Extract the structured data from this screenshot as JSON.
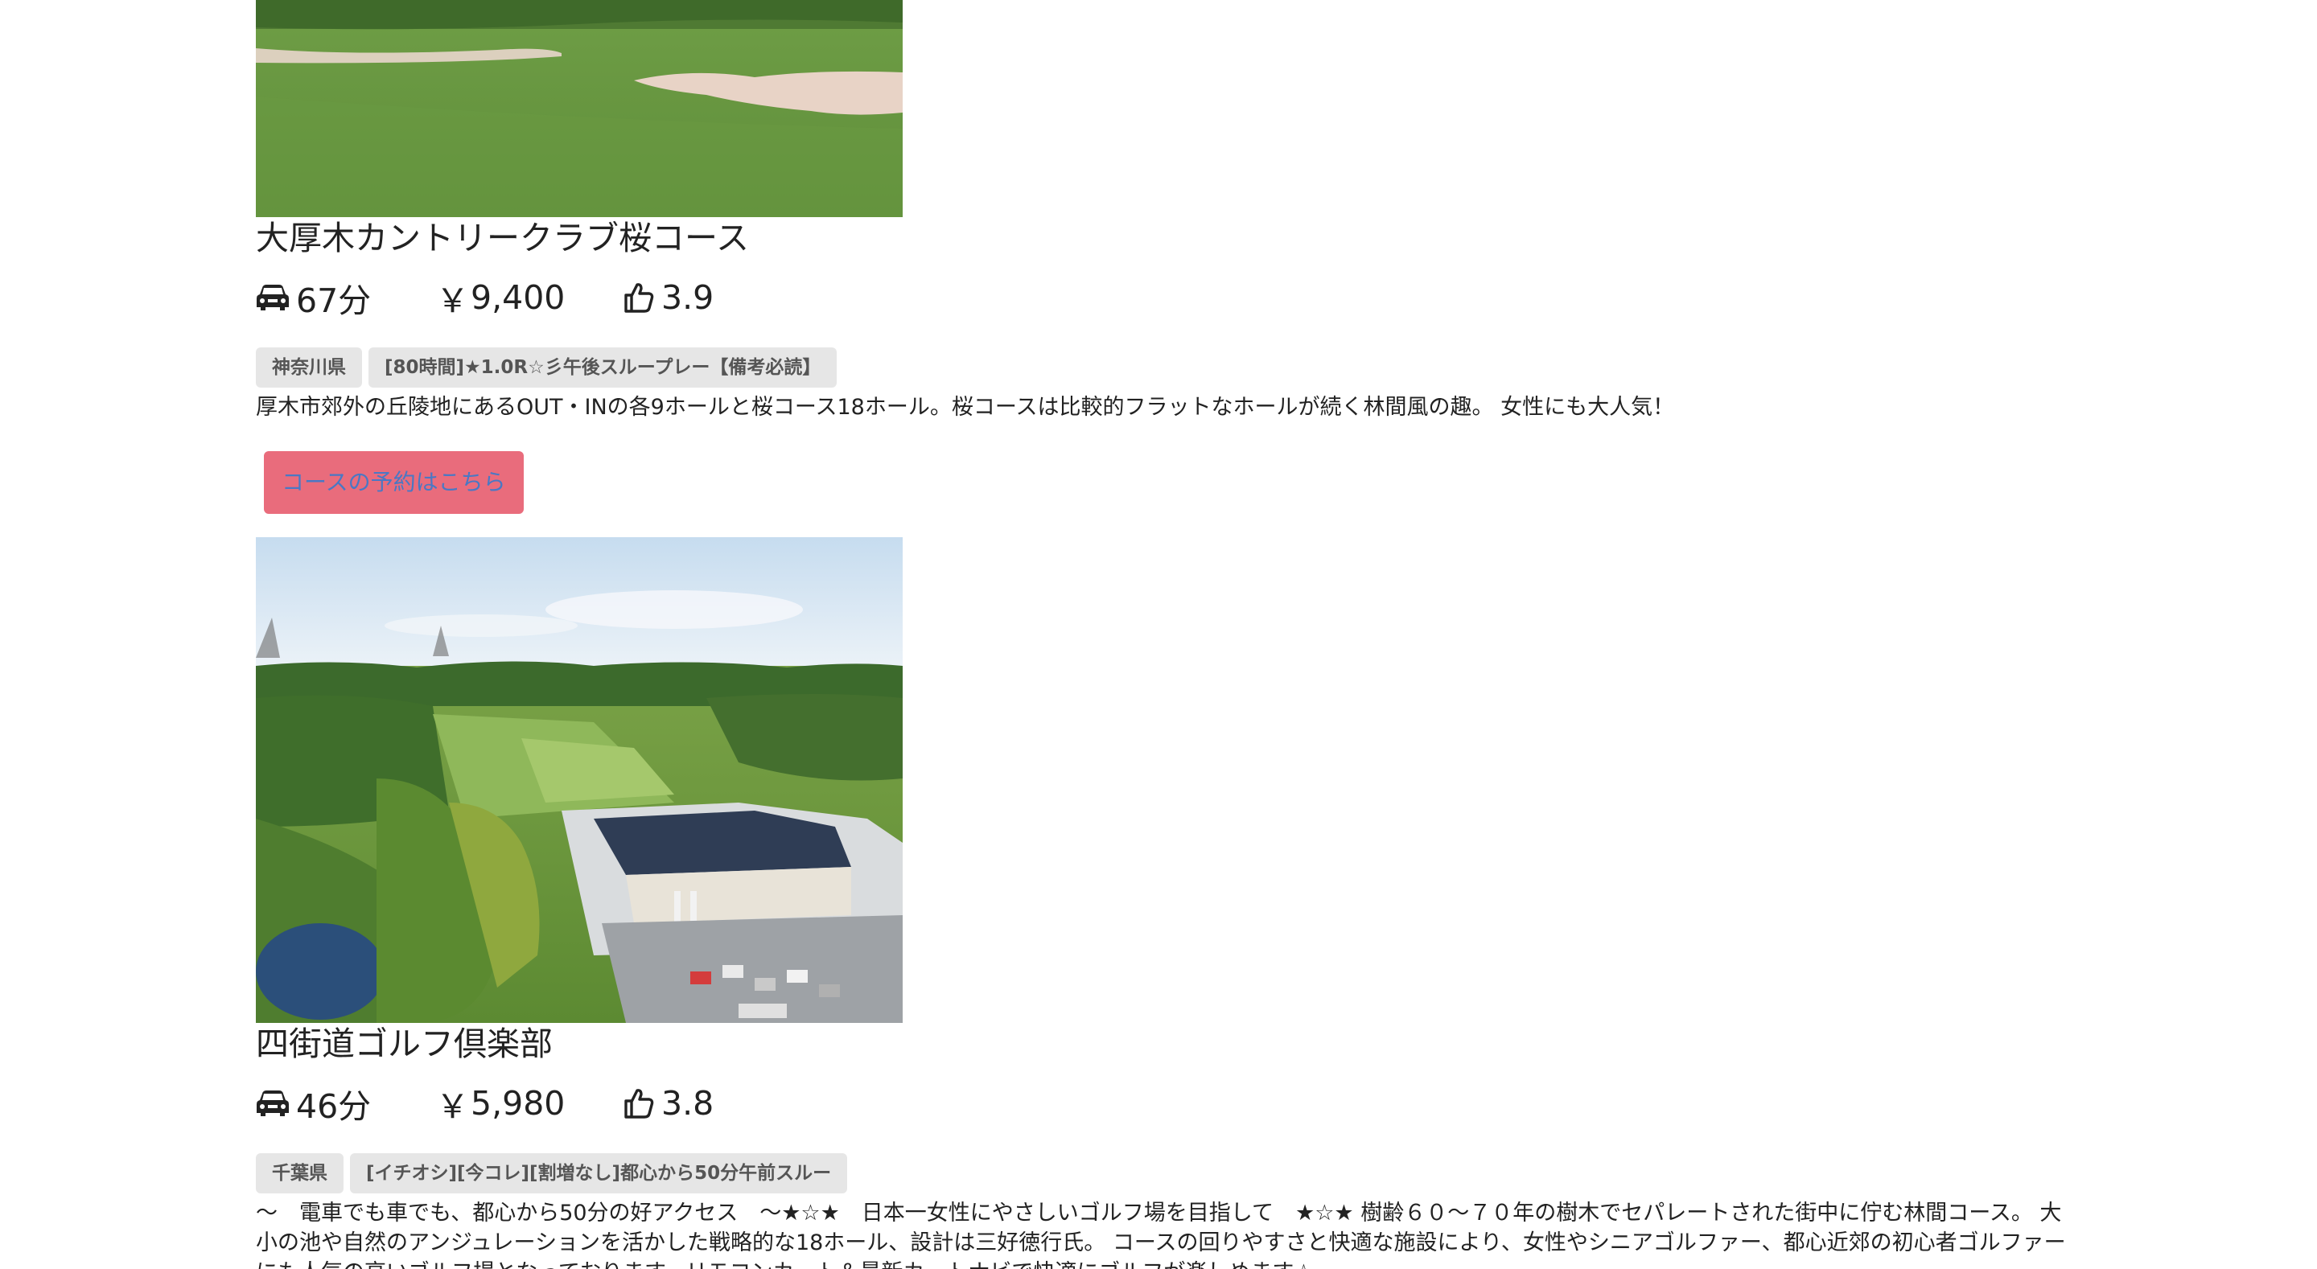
{
  "courses": [
    {
      "name": "大厚木カントリークラブ桜コース",
      "drive_time": "67分",
      "price": "9,400",
      "price_symbol": "￥",
      "rating": "3.9",
      "tags": [
        "神奈川県",
        "[80時間]★1.0R☆彡午後スループレー【備考必読】"
      ],
      "description": "厚木市郊外の丘陵地にあるOUT・INの各9ホールと桜コース18ホール。桜コースは比較的フラットなホールが続く林間風の趣。 女性にも大人気！",
      "reserve_label": "コースの予約はこちら"
    },
    {
      "name": "四街道ゴルフ倶楽部",
      "drive_time": "46分",
      "price": "5,980",
      "price_symbol": "￥",
      "rating": "3.8",
      "tags": [
        "千葉県",
        "[イチオシ][今コレ][割増なし]都心から50分午前スルー"
      ],
      "description": "〜　電車でも車でも、都心から50分の好アクセス　〜★☆★　日本一女性にやさしいゴルフ場を目指して　★☆★ 樹齢６０〜７０年の樹木でセパレートされた街中に佇む林間コース。 大小の池や自然のアンジュレーションを活かした戦略的な18ホール、設計は三好徳行氏。 コースの回りやすさと快適な施設により、女性やシニアゴルファー、都心近郊の初心者ゴルファーにも人気の高いゴルフ場となっております。リモコンカート＆最新カートナビで快適にゴルフが楽しめます☆"
    }
  ],
  "icons": {
    "drive": "car-icon",
    "rating": "thumbs-up-icon"
  },
  "colors": {
    "reserve_button_bg": "#e96c7c",
    "reserve_button_text": "#4a78c4",
    "tag_bg": "#e6e6e6"
  }
}
